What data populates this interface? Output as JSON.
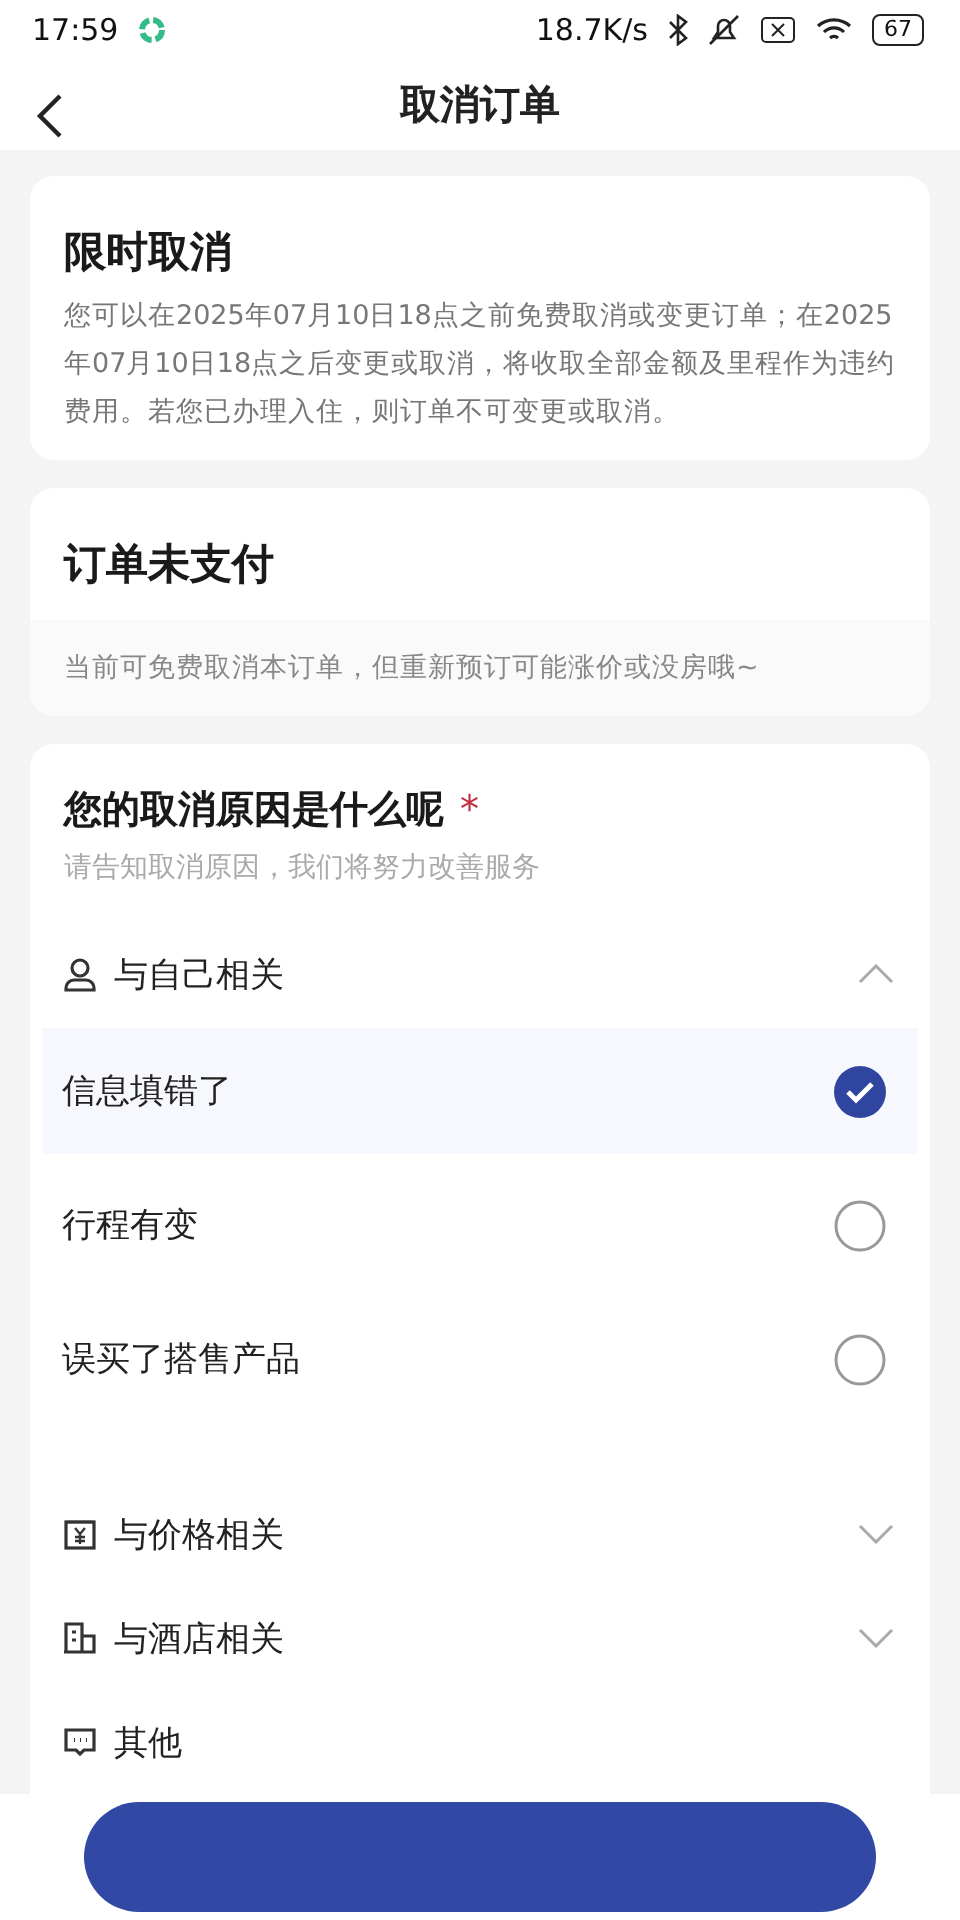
{
  "status_bar": {
    "time": "17:59",
    "speed": "18.7K/s",
    "battery": "67"
  },
  "nav": {
    "title": "取消订单"
  },
  "policy": {
    "title": "限时取消",
    "text": "您可以在2025年07月10日18点之前免费取消或变更订单；在2025年07月10日18点之后变更或取消，将收取全部金额及里程作为违约费用。若您已办理入住，则订单不可变更或取消。"
  },
  "unpaid": {
    "title": "订单未支付",
    "note": "当前可免费取消本订单，但重新预订可能涨价或没房哦~"
  },
  "reasons": {
    "title": "您的取消原因是什么呢",
    "required_mark": "*",
    "subtitle": "请告知取消原因，我们将努力改善服务",
    "groups": [
      {
        "label": "与自己相关",
        "kind": "person",
        "expanded": true,
        "options": [
          {
            "label": "信息填错了",
            "selected": true
          },
          {
            "label": "行程有变",
            "selected": false
          },
          {
            "label": "误买了搭售产品",
            "selected": false
          }
        ]
      },
      {
        "label": "与价格相关",
        "kind": "price",
        "expanded": false
      },
      {
        "label": "与酒店相关",
        "kind": "hotel",
        "expanded": false
      },
      {
        "label": "其他",
        "kind": "chat"
      }
    ]
  },
  "submit": {
    "kind": "button"
  }
}
